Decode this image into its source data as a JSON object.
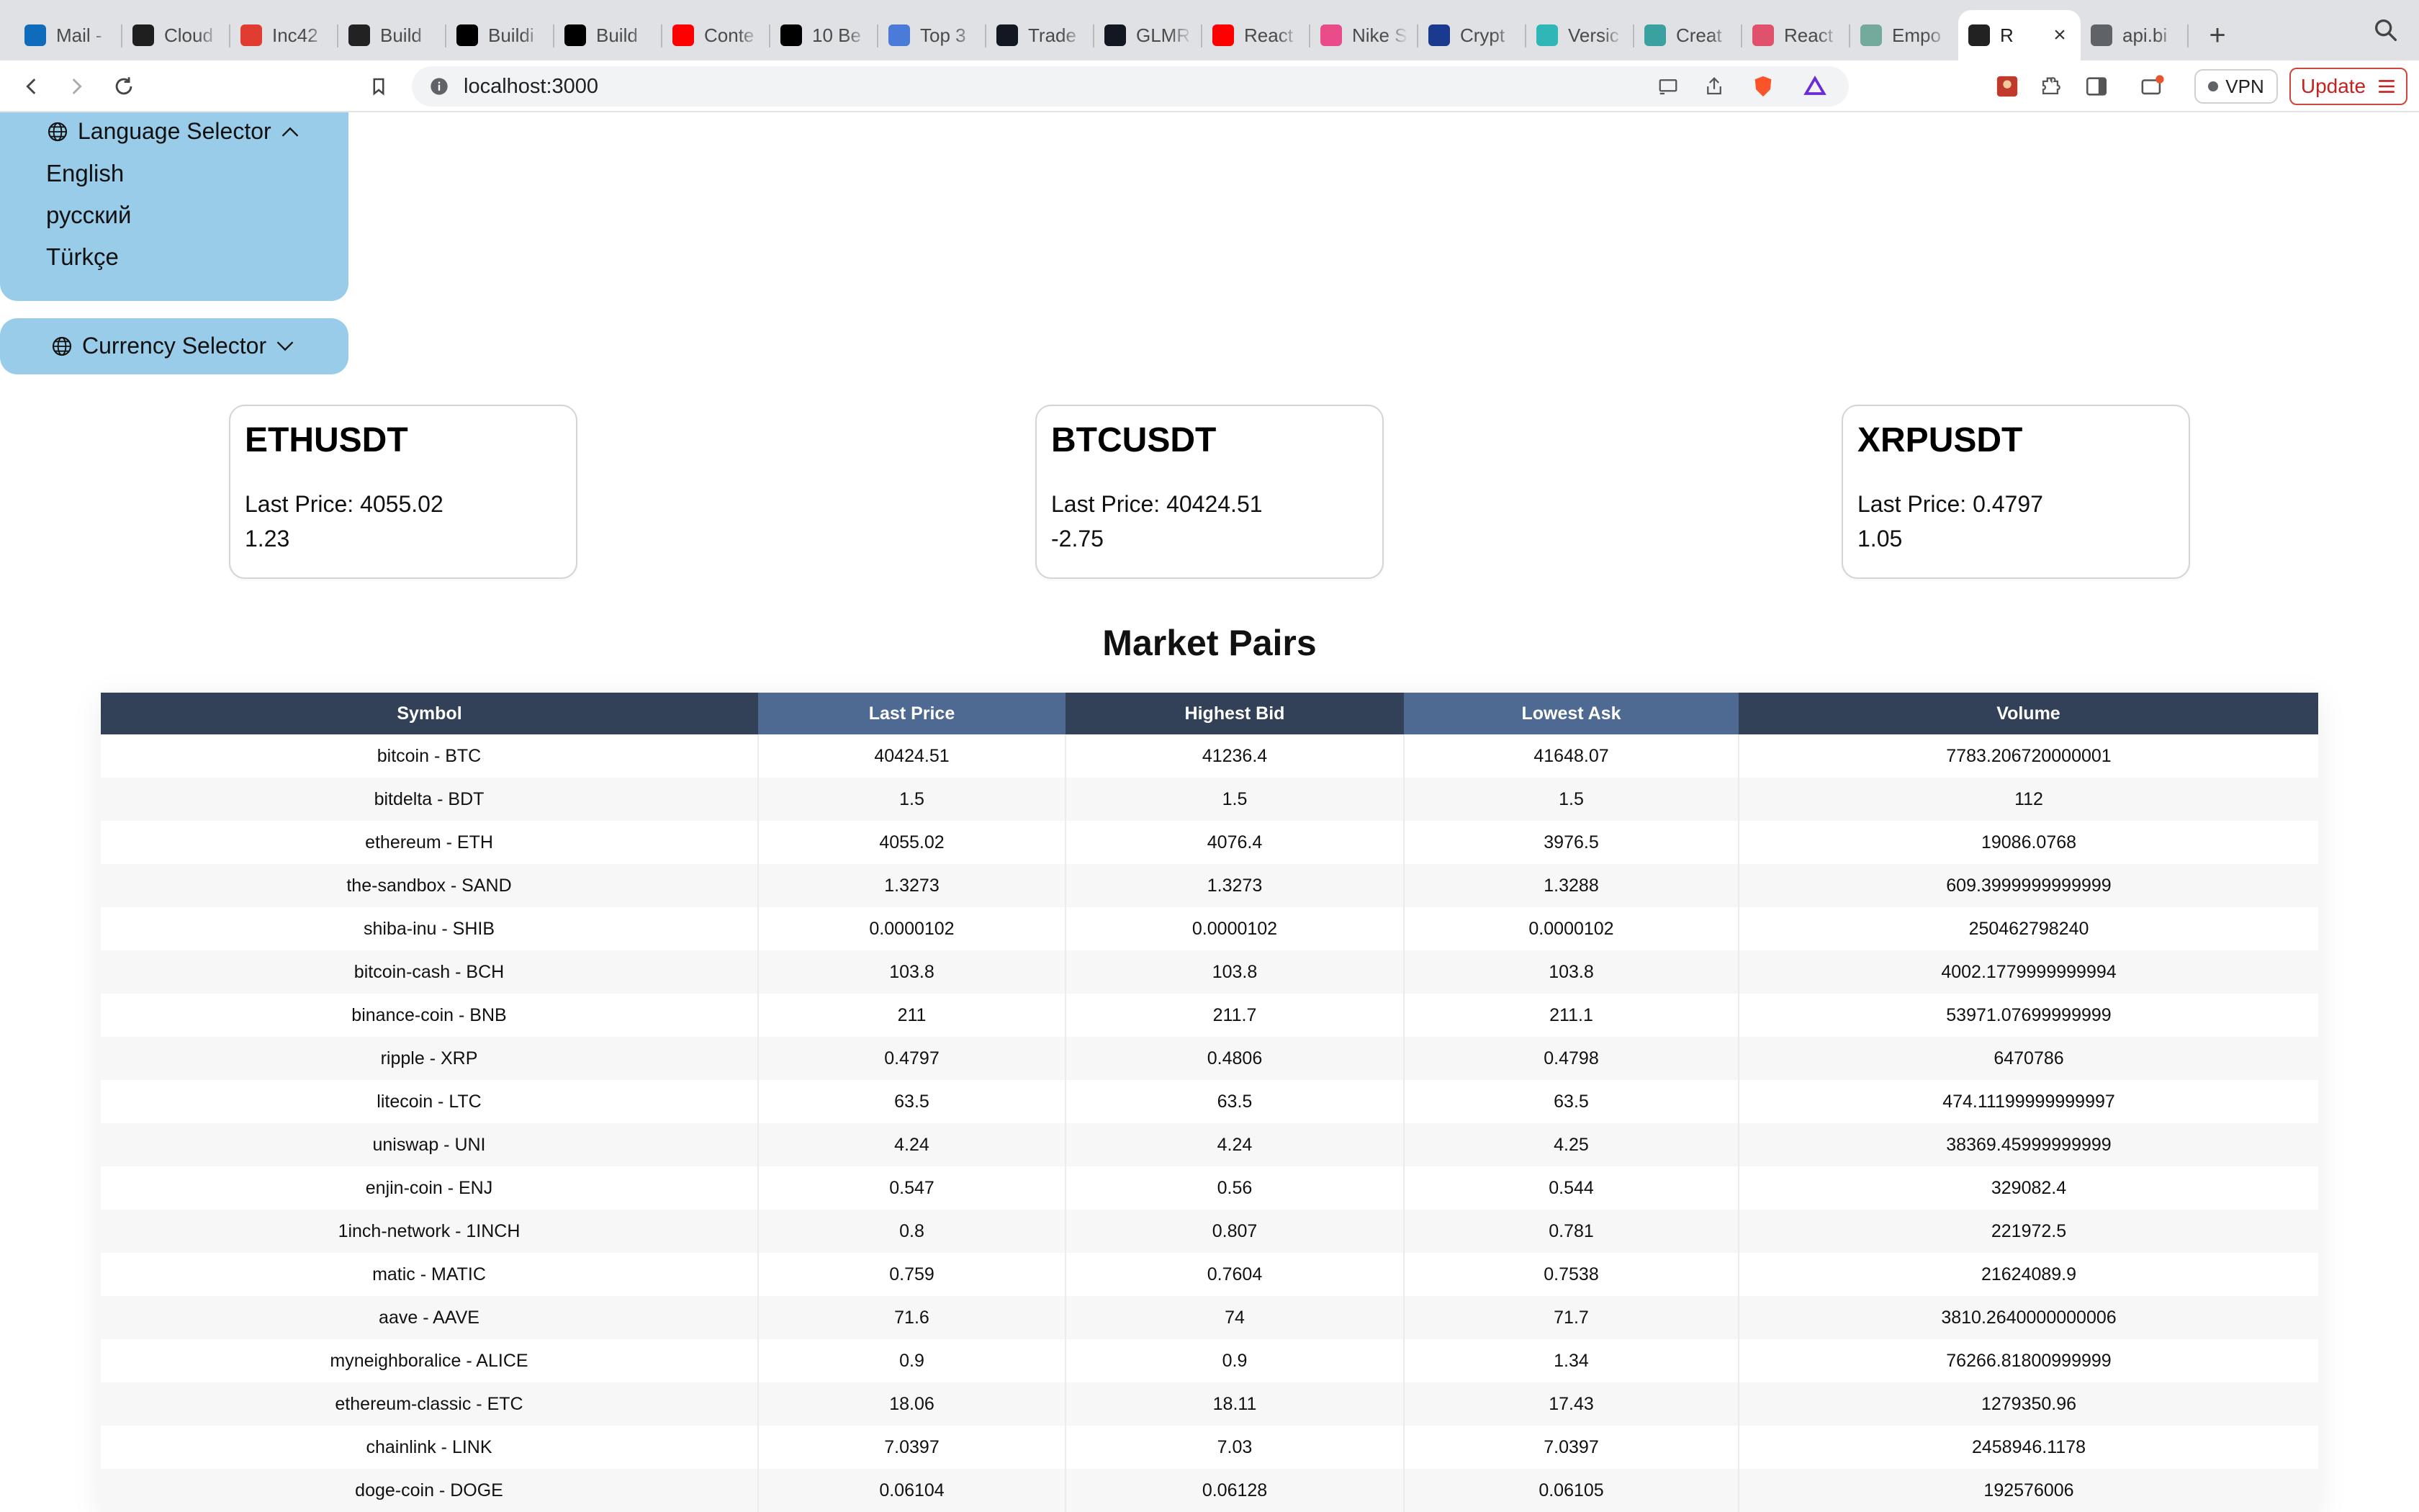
{
  "browser": {
    "tabs": [
      {
        "label": "Mail -",
        "icon": "outlook-icon",
        "color": "#0f6cbd"
      },
      {
        "label": "Cloud",
        "icon": "mongodb-icon",
        "color": "#1f1f1f"
      },
      {
        "label": "Inc42",
        "icon": "inc42-icon",
        "color": "#e03c31"
      },
      {
        "label": "Build",
        "icon": "build-icon",
        "color": "#222222"
      },
      {
        "label": "Buildi",
        "icon": "medium-icon",
        "color": "#000000"
      },
      {
        "label": "Build",
        "icon": "square-icon",
        "color": "#000000"
      },
      {
        "label": "Conte",
        "icon": "youtube-icon",
        "color": "#ff0000"
      },
      {
        "label": "10 Be",
        "icon": "medium-icon",
        "color": "#000000"
      },
      {
        "label": "Top 3",
        "icon": "ik-icon",
        "color": "#4b7bd8"
      },
      {
        "label": "Trade",
        "icon": "tradingview-icon",
        "color": "#131722"
      },
      {
        "label": "GLMR",
        "icon": "tradingview-icon",
        "color": "#131722"
      },
      {
        "label": "React",
        "icon": "youtube-icon",
        "color": "#ff0000"
      },
      {
        "label": "Nike S",
        "icon": "dribbble-icon",
        "color": "#ea4c89"
      },
      {
        "label": "Crypt",
        "icon": "crypto-icon",
        "color": "#1a3a8f"
      },
      {
        "label": "Versic",
        "icon": "bolt-icon",
        "color": "#2fb6b6"
      },
      {
        "label": "Creat",
        "icon": "b-icon",
        "color": "#3aa0a0"
      },
      {
        "label": "React",
        "icon": "react-icon",
        "color": "#e0526b"
      },
      {
        "label": "Empo",
        "icon": "openai-icon",
        "color": "#74aa9c"
      },
      {
        "label": "R",
        "icon": "react-icon",
        "color": "#222222",
        "active": true
      },
      {
        "label": "api.bi",
        "icon": "globe-icon",
        "color": "#5f6368"
      }
    ],
    "url": "localhost:3000",
    "vpn_label": "VPN",
    "update_label": "Update"
  },
  "language_selector": {
    "title": "Language Selector",
    "options": [
      "English",
      "русский",
      "Türkçe"
    ]
  },
  "currency_selector": {
    "title": "Currency Selector"
  },
  "cards": [
    {
      "symbol": "ETHUSDT",
      "price_label": "Last Price:",
      "price": "4055.02",
      "change": "1.23"
    },
    {
      "symbol": "BTCUSDT",
      "price_label": "Last Price:",
      "price": "40424.51",
      "change": "-2.75"
    },
    {
      "symbol": "XRPUSDT",
      "price_label": "Last Price:",
      "price": "0.4797",
      "change": "1.05"
    }
  ],
  "table": {
    "title": "Market Pairs",
    "columns": [
      "Symbol",
      "Last Price",
      "Highest Bid",
      "Lowest Ask",
      "Volume"
    ],
    "rows": [
      [
        "bitcoin - BTC",
        "40424.51",
        "41236.4",
        "41648.07",
        "7783.206720000001"
      ],
      [
        "bitdelta - BDT",
        "1.5",
        "1.5",
        "1.5",
        "112"
      ],
      [
        "ethereum - ETH",
        "4055.02",
        "4076.4",
        "3976.5",
        "19086.0768"
      ],
      [
        "the-sandbox - SAND",
        "1.3273",
        "1.3273",
        "1.3288",
        "609.3999999999999"
      ],
      [
        "shiba-inu - SHIB",
        "0.0000102",
        "0.0000102",
        "0.0000102",
        "250462798240"
      ],
      [
        "bitcoin-cash - BCH",
        "103.8",
        "103.8",
        "103.8",
        "4002.1779999999994"
      ],
      [
        "binance-coin - BNB",
        "211",
        "211.7",
        "211.1",
        "53971.07699999999"
      ],
      [
        "ripple - XRP",
        "0.4797",
        "0.4806",
        "0.4798",
        "6470786"
      ],
      [
        "litecoin - LTC",
        "63.5",
        "63.5",
        "63.5",
        "474.11199999999997"
      ],
      [
        "uniswap - UNI",
        "4.24",
        "4.24",
        "4.25",
        "38369.45999999999"
      ],
      [
        "enjin-coin - ENJ",
        "0.547",
        "0.56",
        "0.544",
        "329082.4"
      ],
      [
        "1inch-network - 1INCH",
        "0.8",
        "0.807",
        "0.781",
        "221972.5"
      ],
      [
        "matic - MATIC",
        "0.759",
        "0.7604",
        "0.7538",
        "21624089.9"
      ],
      [
        "aave - AAVE",
        "71.6",
        "74",
        "71.7",
        "3810.2640000000006"
      ],
      [
        "myneighboralice - ALICE",
        "0.9",
        "0.9",
        "1.34",
        "76266.81800999999"
      ],
      [
        "ethereum-classic - ETC",
        "18.06",
        "18.11",
        "17.43",
        "1279350.96"
      ],
      [
        "chainlink - LINK",
        "7.0397",
        "7.03",
        "7.0397",
        "2458946.1178"
      ],
      [
        "doge-coin - DOGE",
        "0.06104",
        "0.06128",
        "0.06105",
        "192576006"
      ]
    ]
  },
  "colors": {
    "selector_bg": "#98cce8",
    "header_dark": "#334158",
    "header_light": "#4f6a92",
    "update_accent": "#c5221f"
  }
}
